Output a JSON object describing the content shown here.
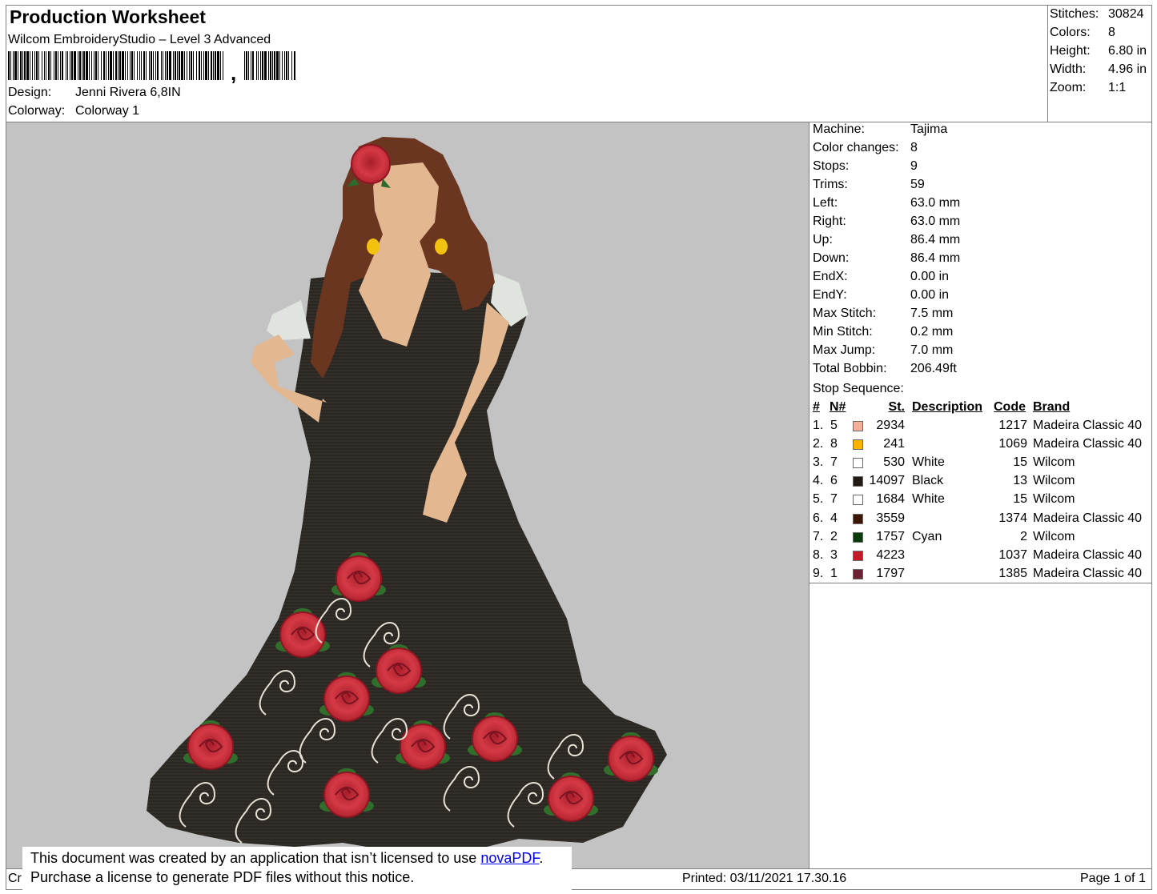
{
  "header": {
    "title": "Production Worksheet",
    "subtitle": "Wilcom EmbroideryStudio – Level 3 Advanced",
    "barcode_text": ",",
    "design_label": "Design:",
    "design_value": "Jenni Rivera 6,8IN",
    "colorway_label": "Colorway:",
    "colorway_value": "Colorway 1"
  },
  "summary": [
    {
      "key": "Stitches:",
      "value": "30824"
    },
    {
      "key": "Colors:",
      "value": "8"
    },
    {
      "key": "Height:",
      "value": "6.80 in"
    },
    {
      "key": "Width:",
      "value": "4.96 in"
    },
    {
      "key": "Zoom:",
      "value": "1:1"
    }
  ],
  "info": [
    {
      "key": "Machine:",
      "value": "Tajima"
    },
    {
      "key": "Color changes:",
      "value": "8"
    },
    {
      "key": "Stops:",
      "value": "9"
    },
    {
      "key": "Trims:",
      "value": "59"
    },
    {
      "key": "Left:",
      "value": "63.0 mm"
    },
    {
      "key": "Right:",
      "value": "63.0 mm"
    },
    {
      "key": "Up:",
      "value": "86.4 mm"
    },
    {
      "key": "Down:",
      "value": "86.4 mm"
    },
    {
      "key": "EndX:",
      "value": "0.00 in"
    },
    {
      "key": "EndY:",
      "value": "0.00 in"
    },
    {
      "key": "Max Stitch:",
      "value": "7.5 mm"
    },
    {
      "key": "Min Stitch:",
      "value": "0.2 mm"
    },
    {
      "key": "Max Jump:",
      "value": "7.0 mm"
    },
    {
      "key": "Total Bobbin:",
      "value": "206.49ft"
    }
  ],
  "stop_sequence": {
    "label": "Stop Sequence:",
    "headers": {
      "num": "#",
      "n": "N#",
      "st": "St.",
      "desc": "Description",
      "code": "Code",
      "brand": "Brand"
    },
    "rows": [
      {
        "num": "1.",
        "n": "5",
        "color": "#f2b09a",
        "st": "2934",
        "desc": "",
        "code": "1217",
        "brand": "Madeira Classic 40"
      },
      {
        "num": "2.",
        "n": "8",
        "color": "#f7b300",
        "st": "241",
        "desc": "",
        "code": "1069",
        "brand": "Madeira Classic 40"
      },
      {
        "num": "3.",
        "n": "7",
        "color": "#ffffff",
        "st": "530",
        "desc": "White",
        "code": "15",
        "brand": "Wilcom"
      },
      {
        "num": "4.",
        "n": "6",
        "color": "#221a14",
        "st": "14097",
        "desc": "Black",
        "code": "13",
        "brand": "Wilcom"
      },
      {
        "num": "5.",
        "n": "7",
        "color": "#ffffff",
        "st": "1684",
        "desc": "White",
        "code": "15",
        "brand": "Wilcom"
      },
      {
        "num": "6.",
        "n": "4",
        "color": "#3e1608",
        "st": "3559",
        "desc": "",
        "code": "1374",
        "brand": "Madeira Classic 40"
      },
      {
        "num": "7.",
        "n": "2",
        "color": "#0b3a0b",
        "st": "1757",
        "desc": "Cyan",
        "code": "2",
        "brand": "Wilcom"
      },
      {
        "num": "8.",
        "n": "3",
        "color": "#c41a28",
        "st": "4223",
        "desc": "",
        "code": "1037",
        "brand": "Madeira Classic 40"
      },
      {
        "num": "9.",
        "n": "1",
        "color": "#6a2234",
        "st": "1797",
        "desc": "",
        "code": "1385",
        "brand": "Madeira Classic 40"
      }
    ]
  },
  "notice": {
    "line1_prefix": "This document was created by an application that isn’t licensed to use ",
    "link": "novaPDF",
    "line1_suffix": ".",
    "line2": "Purchase a license to generate PDF files without this notice."
  },
  "footer": {
    "cr": "Cr",
    "printed": "Printed: 03/11/2021 17.30.16",
    "page": "Page 1 of 1"
  }
}
